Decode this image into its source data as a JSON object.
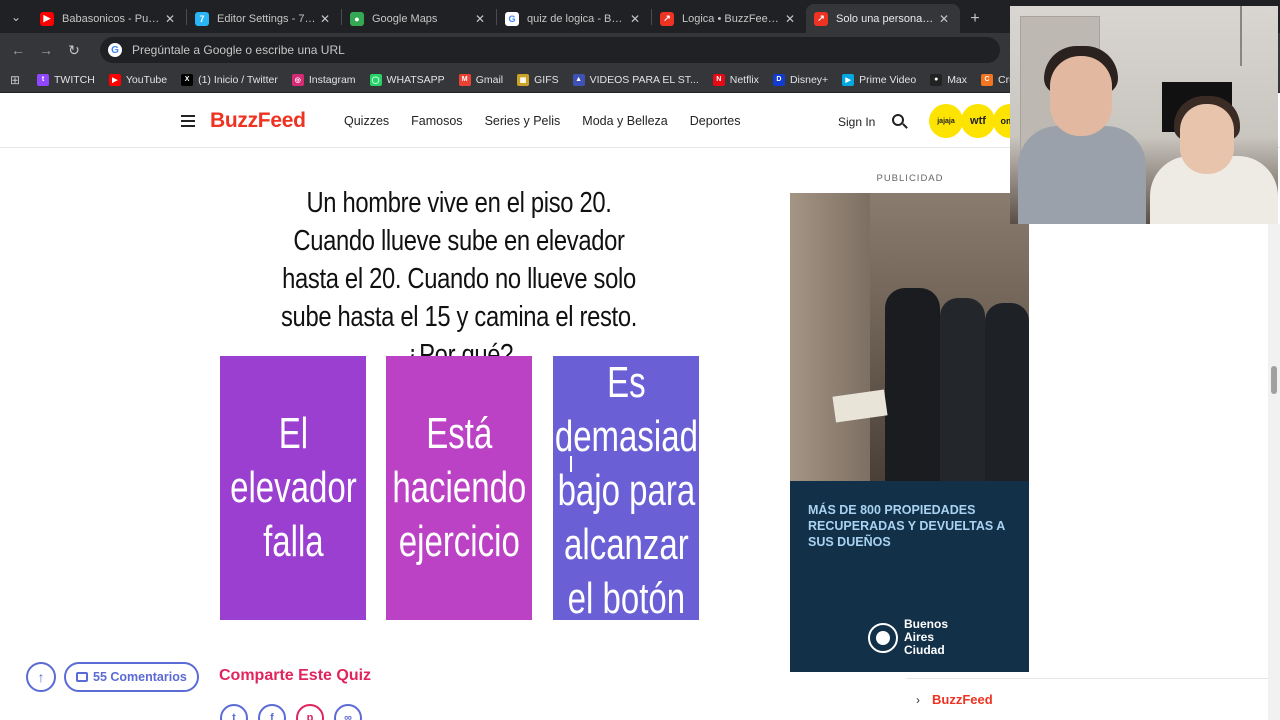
{
  "tabs": [
    {
      "title": "Babasonicos - Putita (",
      "favicon": "youtube-icon",
      "color": "#ff0000"
    },
    {
      "title": "Editor Settings - 7TV",
      "favicon": "7tv-icon",
      "color": "#29b6f6"
    },
    {
      "title": "Google Maps",
      "favicon": "maps-icon",
      "color": "#34a853"
    },
    {
      "title": "quiz de logica - Buscar",
      "favicon": "google-icon",
      "color": "#4285f4"
    },
    {
      "title": "Logica • BuzzFeed Bus",
      "favicon": "buzzfeed-icon",
      "color": "#ee3322"
    },
    {
      "title": "Solo una persona con",
      "favicon": "buzzfeed-icon",
      "color": "#ee3322"
    }
  ],
  "omnibox": {
    "placeholder": "Pregúntale a Google o escribe una URL"
  },
  "bookmarks": [
    {
      "label": "TWITCH",
      "icon": "twitch-icon",
      "color": "#9146ff"
    },
    {
      "label": "YouTube",
      "icon": "youtube-icon",
      "color": "#ff0000"
    },
    {
      "label": "(1) Inicio / Twitter",
      "icon": "x-icon",
      "color": "#000000"
    },
    {
      "label": "Instagram",
      "icon": "instagram-icon",
      "color": "#d62976"
    },
    {
      "label": "WHATSAPP",
      "icon": "whatsapp-icon",
      "color": "#25d366"
    },
    {
      "label": "Gmail",
      "icon": "gmail-icon",
      "color": "#ea4335"
    },
    {
      "label": "GIFS",
      "icon": "gifs-icon",
      "color": "#c9a227"
    },
    {
      "label": "VIDEOS PARA EL ST...",
      "icon": "videos-icon",
      "color": "#3f51b5"
    },
    {
      "label": "Netflix",
      "icon": "netflix-icon",
      "color": "#e50914"
    },
    {
      "label": "Disney+",
      "icon": "disney-icon",
      "color": "#113ccf"
    },
    {
      "label": "Prime Video",
      "icon": "prime-icon",
      "color": "#00a8e1"
    },
    {
      "label": "Max",
      "icon": "max-icon",
      "color": "#222222"
    },
    {
      "label": "Crunchyroll",
      "icon": "crunchyroll-icon",
      "color": "#f47521"
    }
  ],
  "header": {
    "logo": "BuzzFeed",
    "nav": [
      "Quizzes",
      "Famosos",
      "Series y Pelis",
      "Moda y Belleza",
      "Deportes"
    ],
    "sign_in": "Sign In",
    "badges": [
      "jajaja",
      "wtf",
      "omg"
    ]
  },
  "quiz": {
    "question": "Un hombre vive en el piso 20. Cuando llueve sube en elevador hasta el 20. Cuando no llueve solo sube hasta el 15 y camina el resto. ¿Por qué?",
    "answers": [
      {
        "text": "El elevador falla",
        "lines": [
          "El",
          "elevador",
          "falla"
        ],
        "color": "#9a3fd0"
      },
      {
        "text": "Está haciendo ejercicio",
        "lines": [
          "Está",
          "haciendo",
          "ejercicio"
        ],
        "color": "#bb41c5"
      },
      {
        "text": "Es demasiado bajo para alcanzar el botón",
        "lines": [
          "Es",
          "demasiad",
          "bajo para",
          "alcanzar",
          "el botón"
        ],
        "color": "#6a5fd4"
      }
    ],
    "share_title": "Comparte Este Quiz",
    "comments_label": "55 Comentarios"
  },
  "ad": {
    "label": "PUBLICIDAD",
    "headline": "MÁS DE 800 PROPIEDADES RECUPERADAS Y DEVUELTAS A SUS DUEÑOS",
    "sponsor_line1": "Buenos",
    "sponsor_line2": "Aires",
    "sponsor_line3": "Ciudad"
  },
  "bottom_bar": {
    "logo": "BuzzFeed"
  }
}
